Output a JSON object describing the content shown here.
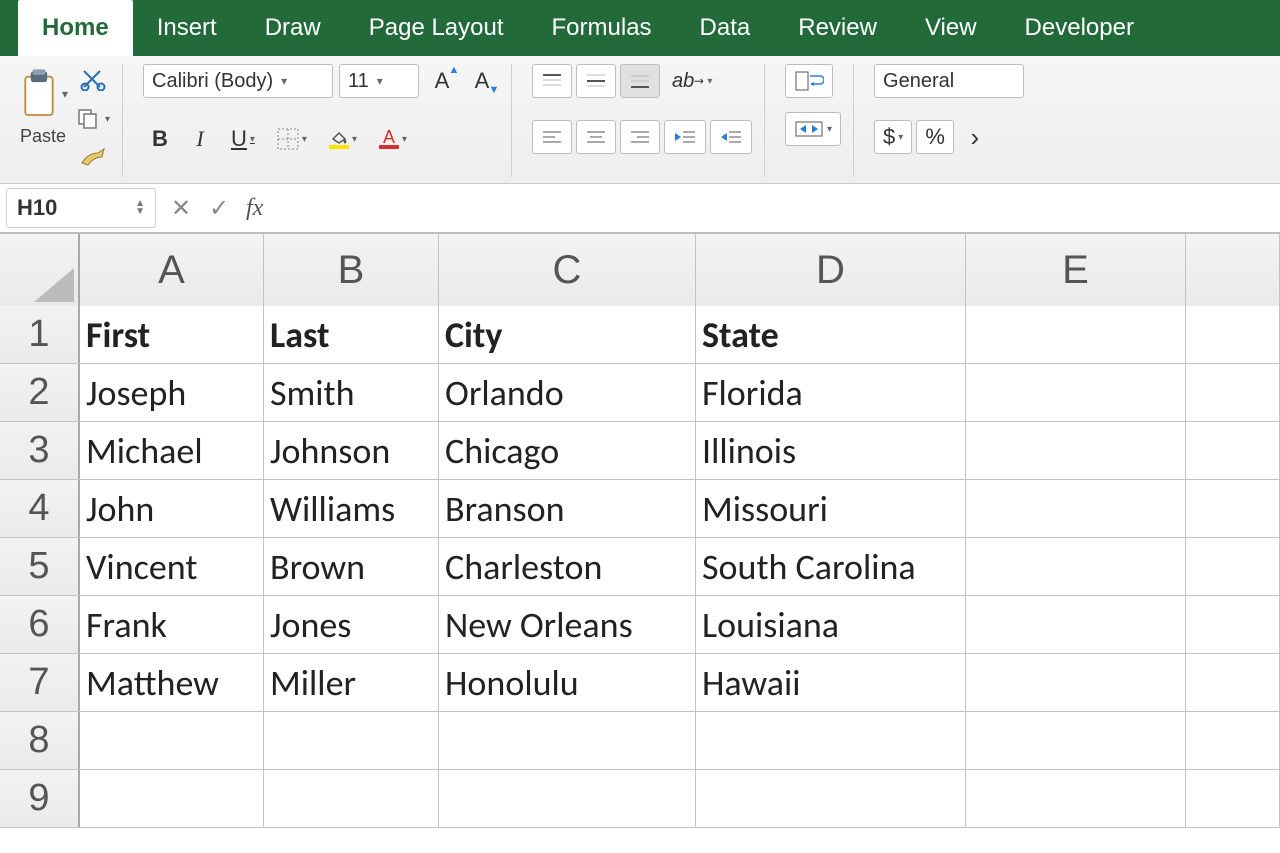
{
  "tabs": [
    "Home",
    "Insert",
    "Draw",
    "Page Layout",
    "Formulas",
    "Data",
    "Review",
    "View",
    "Developer"
  ],
  "active_tab": "Home",
  "clipboard": {
    "paste_label": "Paste"
  },
  "font": {
    "name": "Calibri (Body)",
    "size": "11",
    "bold": "B",
    "italic": "I",
    "underline": "U",
    "fontcolor_letter": "A",
    "fill_tip": "A",
    "grow": "A",
    "shrink": "A"
  },
  "number": {
    "format": "General",
    "currency": "$",
    "percent": "%"
  },
  "namebox": "H10",
  "fx_label": "fx",
  "columns": [
    "A",
    "B",
    "C",
    "D",
    "E"
  ],
  "row_numbers": [
    "1",
    "2",
    "3",
    "4",
    "5",
    "6",
    "7",
    "8",
    "9"
  ],
  "grid": {
    "headers": [
      "First",
      "Last",
      "City",
      "State"
    ],
    "rows": [
      [
        "Joseph",
        "Smith",
        "Orlando",
        "Florida"
      ],
      [
        "Michael",
        "Johnson",
        "Chicago",
        "Illinois"
      ],
      [
        "John",
        "Williams",
        "Branson",
        "Missouri"
      ],
      [
        "Vincent",
        "Brown",
        "Charleston",
        "South Carolina"
      ],
      [
        "Frank",
        "Jones",
        "New Orleans",
        "Louisiana"
      ],
      [
        "Matthew",
        "Miller",
        "Honolulu",
        "Hawaii"
      ]
    ]
  }
}
